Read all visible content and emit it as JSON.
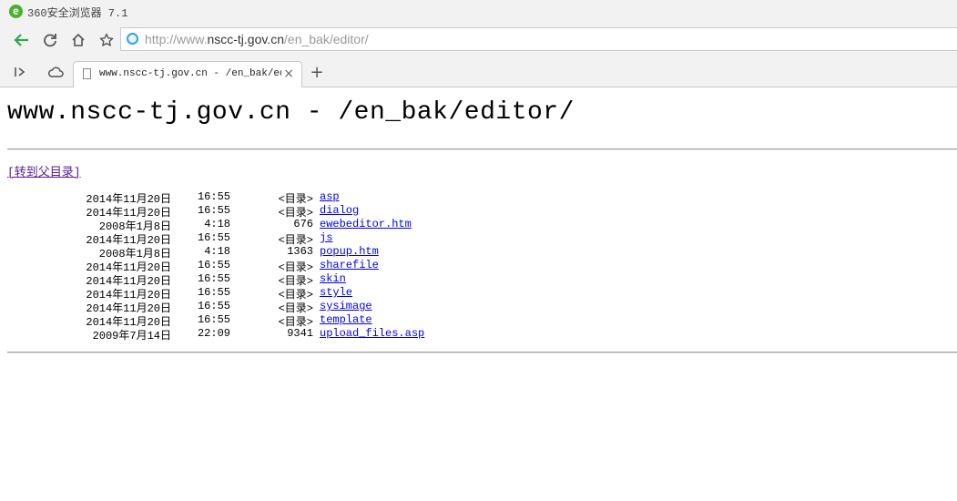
{
  "browser": {
    "app_title": "360安全浏览器 7.1",
    "logo_glyph": "e",
    "address": {
      "scheme": "http://www.",
      "host": "nscc-tj.gov.cn",
      "path": "/en_bak/editor/"
    },
    "tab": {
      "title": "www.nscc-tj.gov.cn - /en_bak/editor/",
      "close_glyph": "×"
    },
    "new_tab_glyph": "+",
    "accent_color": "#2fa84f"
  },
  "page": {
    "title": "www.nscc-tj.gov.cn - /en_bak/editor/",
    "parent_link": "[转到父目录]",
    "entries": [
      {
        "date": "2014年11月20日",
        "time": "16:55",
        "size": "<目录>",
        "name": "asp"
      },
      {
        "date": "2014年11月20日",
        "time": "16:55",
        "size": "<目录>",
        "name": "dialog"
      },
      {
        "date": "2008年1月8日",
        "time": "4:18",
        "size": "676",
        "name": "ewebeditor.htm"
      },
      {
        "date": "2014年11月20日",
        "time": "16:55",
        "size": "<目录>",
        "name": "js"
      },
      {
        "date": "2008年1月8日",
        "time": "4:18",
        "size": "1363",
        "name": "popup.htm"
      },
      {
        "date": "2014年11月20日",
        "time": "16:55",
        "size": "<目录>",
        "name": "sharefile"
      },
      {
        "date": "2014年11月20日",
        "time": "16:55",
        "size": "<目录>",
        "name": "skin"
      },
      {
        "date": "2014年11月20日",
        "time": "16:55",
        "size": "<目录>",
        "name": "style"
      },
      {
        "date": "2014年11月20日",
        "time": "16:55",
        "size": "<目录>",
        "name": "sysimage"
      },
      {
        "date": "2014年11月20日",
        "time": "16:55",
        "size": "<目录>",
        "name": "template"
      },
      {
        "date": "2009年7月14日",
        "time": "22:09",
        "size": "9341",
        "name": "upload_files.asp"
      }
    ]
  }
}
